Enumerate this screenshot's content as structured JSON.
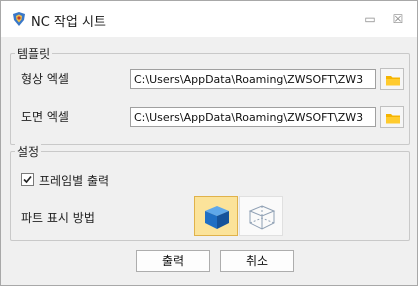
{
  "title": "NC 작업 시트",
  "window_controls": {
    "restore": "▭",
    "close": "☒"
  },
  "template_group": {
    "title": "템플릿",
    "rows": [
      {
        "label": "형상 엑셀",
        "value": "C:\\Users\\AppData\\Roaming\\ZWSOFT\\ZW3"
      },
      {
        "label": "도면 엑셀",
        "value": "C:\\Users\\AppData\\Roaming\\ZWSOFT\\ZW3"
      }
    ]
  },
  "settings_group": {
    "title": "설정",
    "frame_output_label": "프레임별 출력",
    "frame_output_checked": true,
    "part_display_label": "파트 표시 방법",
    "display_modes": [
      {
        "icon": "shaded-cube-icon",
        "selected": true
      },
      {
        "icon": "wireframe-cube-icon",
        "selected": false
      }
    ]
  },
  "buttons": {
    "output": "출력",
    "cancel": "취소"
  },
  "colors": {
    "accent_selected": "#fbe39a",
    "folder": "#f5b400",
    "cube_blue": "#1f6fc4"
  }
}
